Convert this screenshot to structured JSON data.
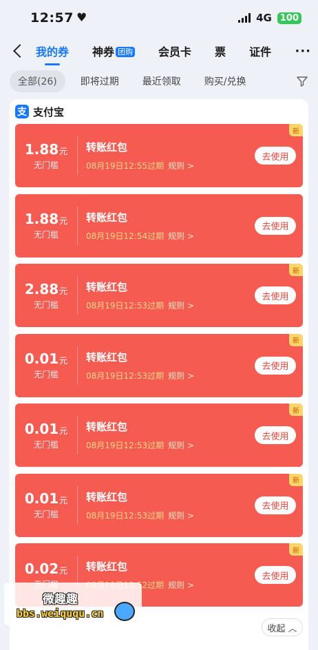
{
  "status_bar": {
    "time": "12:57",
    "network": "4G",
    "battery": "100"
  },
  "nav": {
    "tabs": [
      {
        "label": "我的券",
        "active": true
      },
      {
        "label": "神券",
        "badge": "团购"
      },
      {
        "label": "会员卡"
      },
      {
        "label": "票"
      },
      {
        "label": "证件"
      }
    ]
  },
  "filters": [
    "全部(26)",
    "即将过期",
    "最近领取",
    "购买/兑换"
  ],
  "panel": {
    "title": "支付宝",
    "logo_char": "支"
  },
  "coupons": [
    {
      "amount": "1.88",
      "unit": "元",
      "condition": "无门槛",
      "name": "转账红包",
      "expire": "08月19日12:55过期",
      "rule": "规则 >",
      "action": "去使用",
      "badge": "新"
    },
    {
      "amount": "1.88",
      "unit": "元",
      "condition": "无门槛",
      "name": "转账红包",
      "expire": "08月19日12:54过期",
      "rule": "规则 >",
      "action": "去使用",
      "badge": ""
    },
    {
      "amount": "2.88",
      "unit": "元",
      "condition": "无门槛",
      "name": "转账红包",
      "expire": "08月19日12:53过期",
      "rule": "规则 >",
      "action": "去使用",
      "badge": "新"
    },
    {
      "amount": "0.01",
      "unit": "元",
      "condition": "无门槛",
      "name": "转账红包",
      "expire": "08月19日12:53过期",
      "rule": "规则 >",
      "action": "去使用",
      "badge": "新"
    },
    {
      "amount": "0.01",
      "unit": "元",
      "condition": "无门槛",
      "name": "转账红包",
      "expire": "08月19日12:53过期",
      "rule": "规则 >",
      "action": "去使用",
      "badge": "新"
    },
    {
      "amount": "0.01",
      "unit": "元",
      "condition": "无门槛",
      "name": "转账红包",
      "expire": "08月19日12:53过期",
      "rule": "规则 >",
      "action": "去使用",
      "badge": "新"
    },
    {
      "amount": "0.02",
      "unit": "元",
      "condition": "无门槛",
      "name": "转账红包",
      "expire": "08月19日12:52过期",
      "rule": "规则 >",
      "action": "去使用",
      "badge": "新"
    }
  ],
  "watermark": {
    "title": "微趣趣",
    "url": "bbs.weiququ.cn"
  },
  "collapse_label": "收起"
}
